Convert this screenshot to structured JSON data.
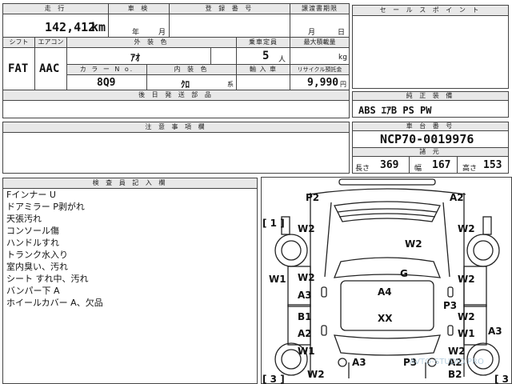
{
  "sheet": {
    "top_labels": {
      "mileage": "走 行",
      "inspection": "車 検",
      "registration": "登 録 番 号",
      "transfer_deadline": "譲渡書期限"
    },
    "mileage_value": "142,412",
    "mileage_unit": "km",
    "inspection_year": "年",
    "inspection_month": "月",
    "deadline_month": "月",
    "deadline_day": "日",
    "labels": {
      "shift": "シフト",
      "aircon": "エアコン",
      "exterior_color": "外 装 色",
      "capacity": "乗車定員",
      "max_load": "最大積載量",
      "color_no": "カ ラ ー N o.",
      "interior_color": "内 装 色",
      "import": "輸 入 車",
      "recycle": "リサイクル預託金",
      "later_docs": "後 日 発 送 部 品",
      "notes": "注 意 事 項 欄",
      "inspector_notes": "検 査 員 記 入 欄",
      "sales_points": "セ ー ル ス ポ イ ン ト",
      "equipment": "純 正 装 備",
      "chassis": "車 台 番 号",
      "specs": "諸 元",
      "length": "長さ",
      "width": "幅",
      "height": "高さ"
    },
    "shift_value": "FAT",
    "aircon_value": "AAC",
    "exterior_color_value": "ｱｵ",
    "capacity_value": "5",
    "capacity_unit": "人",
    "max_load_unit": "kg",
    "color_no_value": "8Q9",
    "interior_color_value": "ｸﾛ",
    "interior_color_suffix": "系",
    "recycle_value": "9,990",
    "recycle_unit": "円",
    "equipment_value": "ABS ｴｱB PS PW",
    "chassis_value": "NCP70-0019976",
    "length_value": "369",
    "width_value": "167",
    "height_value": "153"
  },
  "inspector_notes": [
    "Fインナー U",
    "ドアミラー P剥がれ",
    "天張汚れ",
    "コンソール傷",
    "ハンドルすれ",
    "トランク水入り",
    "室内臭い、汚れ",
    "シート すれ中、汚れ",
    "バンパー下 A",
    "ホイールカバー A、欠品"
  ],
  "diagram": {
    "corner_tl": "[ 1 ]",
    "corner_bl": "[ 3 ]",
    "corner_br": "[ 3",
    "marks": [
      "P2",
      "A2",
      "W2",
      "W2",
      "W2",
      "W2",
      "G",
      "W1",
      "W2",
      "A3",
      "A4",
      "P3",
      "B1",
      "XX",
      "W2",
      "A2",
      "A3",
      "W1",
      "W1",
      "W2",
      "W2",
      "A3",
      "A2",
      "P3",
      "B2"
    ],
    "watermark": "AVTO-STUDIO.PRO"
  }
}
